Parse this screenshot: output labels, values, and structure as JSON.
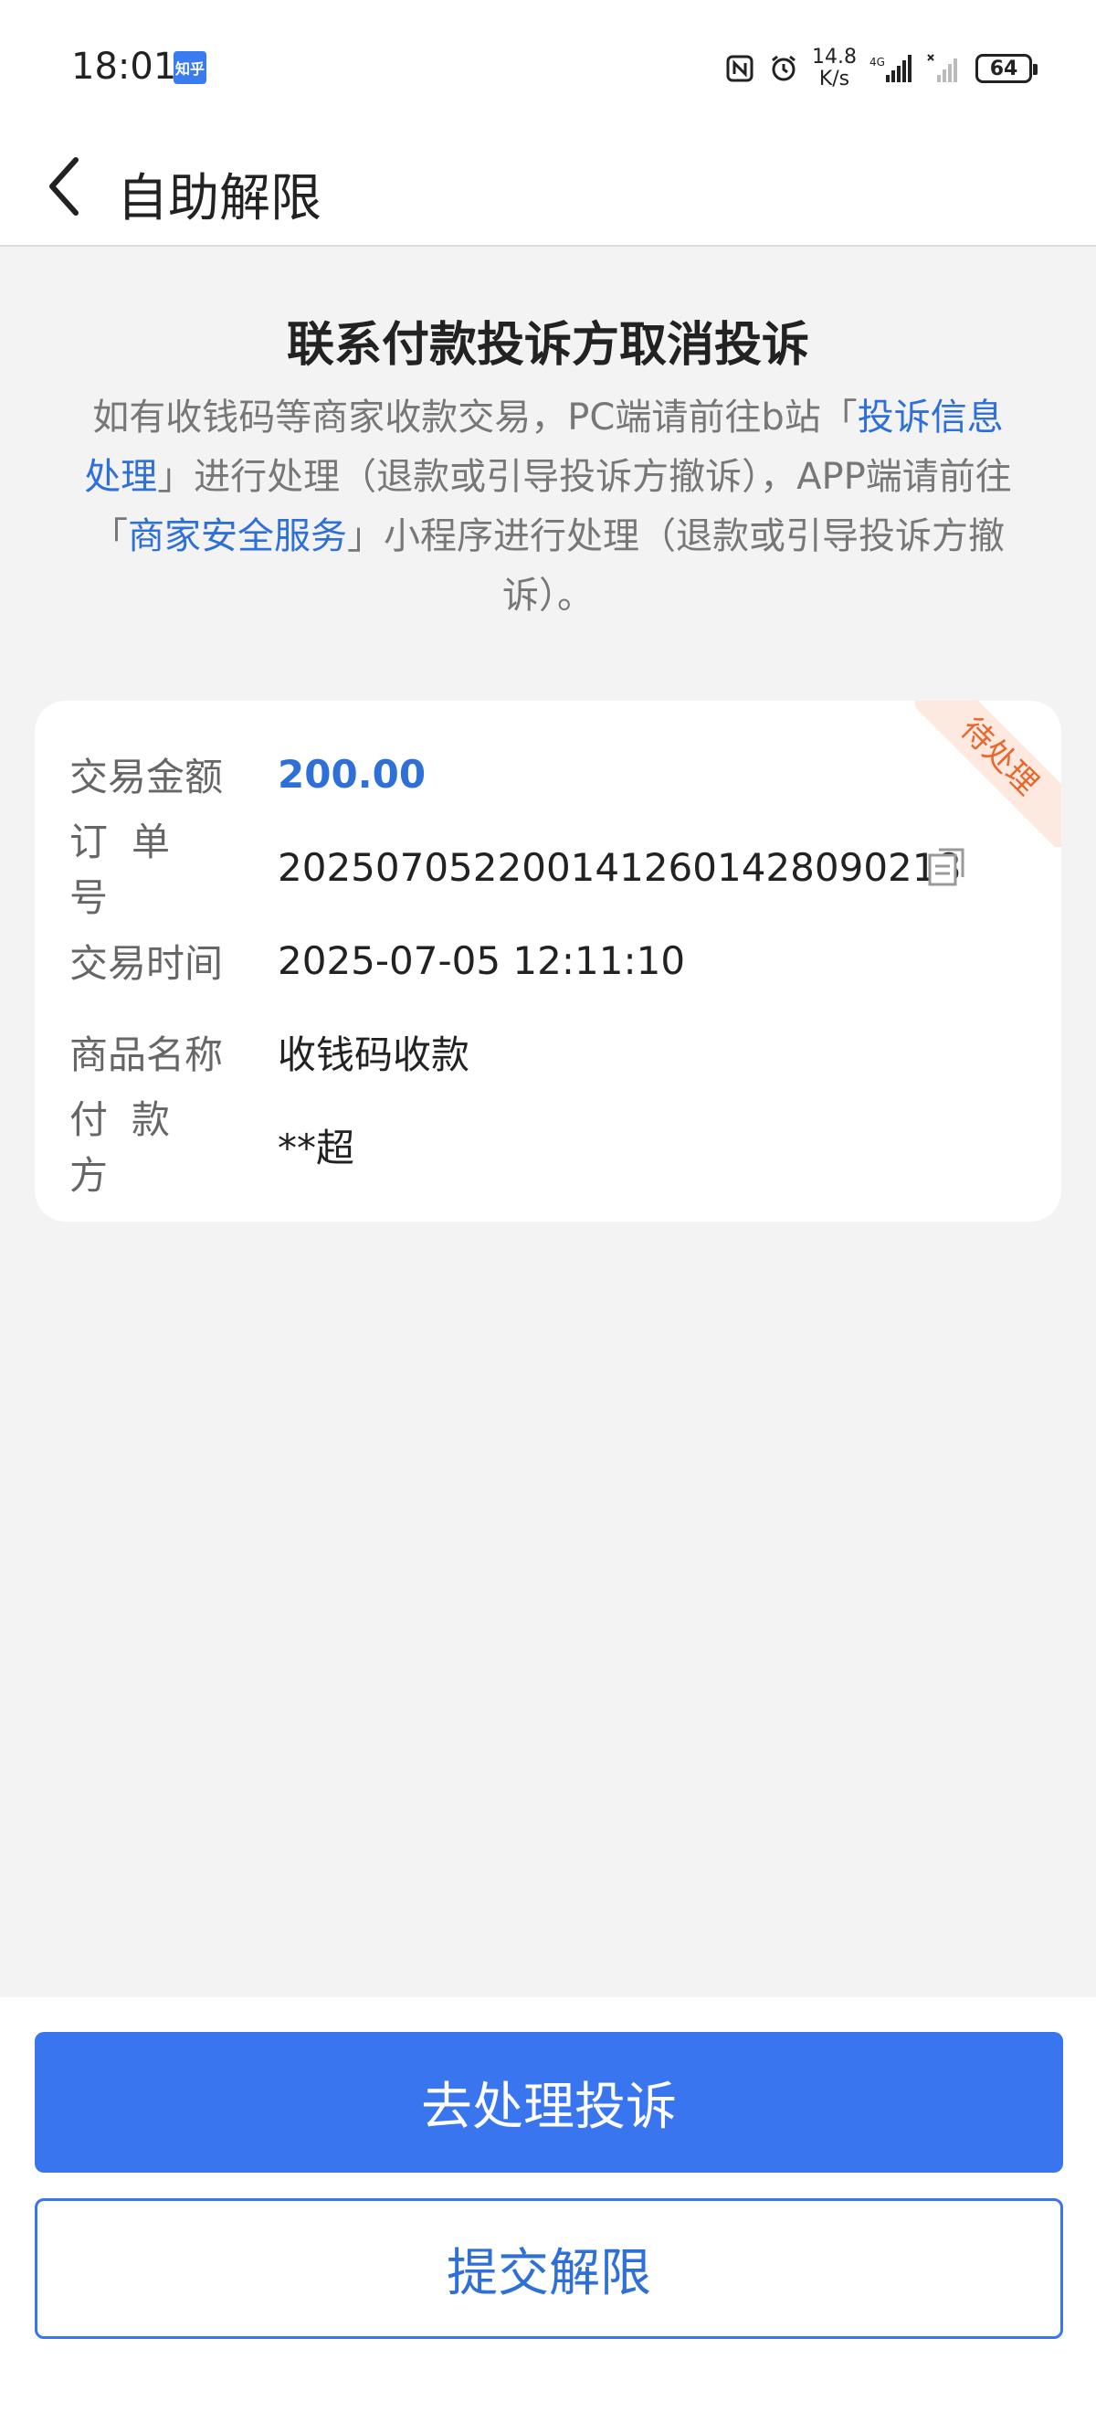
{
  "status_bar": {
    "time": "18:01",
    "app_badge": "知乎",
    "net_speed_value": "14.8",
    "net_speed_unit": "K/s",
    "signal_label": "4G",
    "battery": "64"
  },
  "header": {
    "title": "自助解限"
  },
  "intro": {
    "title": "联系付款投诉方取消投诉",
    "desc_part1": "如有收钱码等商家收款交易，PC端请前往b站「",
    "desc_link1": "投诉信息处理",
    "desc_part2": "」进行处理（退款或引导投诉方撤诉），APP端请前往「",
    "desc_link2": "商家安全服务",
    "desc_part3": "」小程序进行处理（退款或引导投诉方撤诉）。"
  },
  "card": {
    "status_tag": "待处理",
    "rows": [
      {
        "label": "交易金额",
        "value": "200.00"
      },
      {
        "label": "订单号",
        "value": "2025070522001412601428090218"
      },
      {
        "label": "交易时间",
        "value": "2025-07-05 12:11:10"
      },
      {
        "label": "商品名称",
        "value": "收钱码收款"
      },
      {
        "label": "付款方",
        "value": "**超"
      }
    ]
  },
  "actions": {
    "primary_label": "去处理投诉",
    "secondary_label": "提交解限"
  },
  "colors": {
    "accent": "#3a75f0",
    "link": "#2f6fd8",
    "status_tag_text": "#e8672d",
    "status_tag_bg": "#fde9df",
    "background": "#f3f3f3"
  }
}
